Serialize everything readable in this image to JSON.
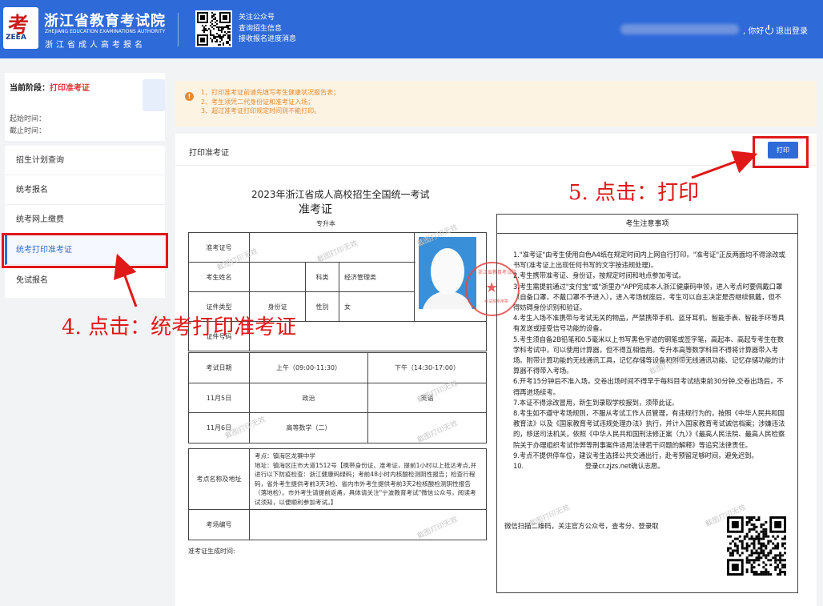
{
  "header": {
    "logo_char": "考",
    "logo_abbr": "ZEEA",
    "title": "浙江省教育考试院",
    "title_en": "ZHEJIANG EDUCATION EXAMINATIONS AUTHORITY",
    "subtitle": "浙江省成人高考报名",
    "wechat_lines": [
      "关注公众号",
      "查询招生信息",
      "接收报名进度消息"
    ],
    "greeting": ", 你好",
    "logout": "退出登录",
    "brand_color": "#2f6ad9"
  },
  "stage": {
    "label": "当前阶段：",
    "value": "打印准考证",
    "start_label": "起始时间：",
    "end_label": "截止时间："
  },
  "sidebar": {
    "items": [
      {
        "label": "招生计划查询"
      },
      {
        "label": "统考报名"
      },
      {
        "label": "统考网上缴费"
      },
      {
        "label": "统考打印准考证",
        "active": true
      },
      {
        "label": "免试报名"
      }
    ]
  },
  "notice": {
    "icon": "!",
    "lines": [
      "1、打印准考证前请先填写考生健康状况报告表；",
      "2、考生须凭二代身份证和准考证入场；",
      "3、超过准考证打印规定时间则不能打印。"
    ]
  },
  "main": {
    "title": "打印准考证",
    "print_button": "打印"
  },
  "admission": {
    "heading": "2023年浙江省成人高校招生全国统一考试",
    "subheading": "准考证",
    "level": "专升本",
    "labels": {
      "ticket_no": "准考证号",
      "name": "考生姓名",
      "subject_cat": "科类",
      "id_type": "证件类型",
      "gender": "性别",
      "id_no": "证件号码",
      "exam_date": "考试日期",
      "am": "上午（09:00-11:30）",
      "pm": "下午（14:30-17:00）",
      "site": "考点名称及地址",
      "room": "考场编号",
      "generated": "准考证生成时间:"
    },
    "values": {
      "subject_cat": "经济管理类",
      "id_type": "身份证",
      "gender": "女"
    },
    "schedule": [
      {
        "date": "11月5日",
        "am": "政治",
        "pm": "英语"
      },
      {
        "date": "11月6日",
        "am": "高等数学（二）",
        "pm": ""
      }
    ],
    "site_text": "考点：镇海区龙赛中学\n地址：镇海区庄市大道1512号【携带身份证、准考证，提前1小时以上抵达考点,并进行以下防疫检查：浙江健康码绿码；考前48小时内核酸检测阴性报告；检查行程码，省外考生提供考前3天3检、省内市外考生提供考前3天2检核酸检测阴性报告（落地检）。市外考生请提前返甬，具体请关注\"宁波教育考试\"微信公众号，阅读考试须知，以便顺利参加考试。】",
    "seal_top": "浙江省教育考试院",
    "seal_bottom": "考试院专用章",
    "watermark": "截图打印无效"
  },
  "notes": {
    "title": "考生注意事项",
    "items": [
      "1.\"准考证\"由考生使用白色A4纸在规定时间内上网自行打印。\"准考证\"正反两面均不得涂改或书写(准考证上出现任何书写的文字按违规处理)。",
      "2.考生携带准考证、身份证，按规定时间和地点参加考试。",
      "3.考生需提前通过\"支付宝\"或\"浙里办\"APP完成本人浙江健康码申领，进入考点时要佩戴口罩（自备口罩，不戴口罩不予进入），进入考场就座后，考生可以自主决定是否继续佩戴，但不得妨碍身份识别和验证。",
      "4.考生入场不准携带与考试无关的物品，严禁携带手机、蓝牙耳机、智能手表、智能手环等具有发送或接受信号功能的设备。",
      "5.考生须自备2B铅笔和0.5毫米以上书写黑色字迹的钢笔或签字笔，高起本、高起专考生在数学科考试中，可以使用计算器，但不得互相借用。专升本高等数学科目不得将计算器带入考场。附带计算功能的无线通讯工具，记忆存储等设备和附带无线通讯功能、记忆存储功能的计算器不得带入考场。",
      "6.开考15分钟后不准入场，交卷出场时间不得早于每科目考试结束前30分钟,交卷出场后，不得再进场续考。",
      "7.本证不得涂改冒用，新生到录取学校报到，须带此证。",
      "8.考生如不遵守考场规则，不服从考试工作人员管理，有违规行为的，按照《中华人民共和国教育法》以及《国家教育考试违规处理办法》执行，并计入国家教育考试诚信档案；涉嫌违法的，移送司法机关，依照《中华人民共和国刑法修正案（九）》《最高人民法院、最高人民检察院关于办理组织考试作弊等刑事案件适用法律若干问题的解释》等追究法律责任。",
      "9.考点不提供停车位，建议考生选择公共交通出行，赴考预留足够时间，避免迟到。",
      "10.                              登录cr.zjzs.net确认志愿。"
    ],
    "footer": "微信扫描二维码，关注官方公众号，查考分、登录取"
  },
  "callouts": {
    "step4": "4. 点击：统考打印准考证",
    "step5": "5. 点击：打印",
    "color": "#e01818"
  }
}
